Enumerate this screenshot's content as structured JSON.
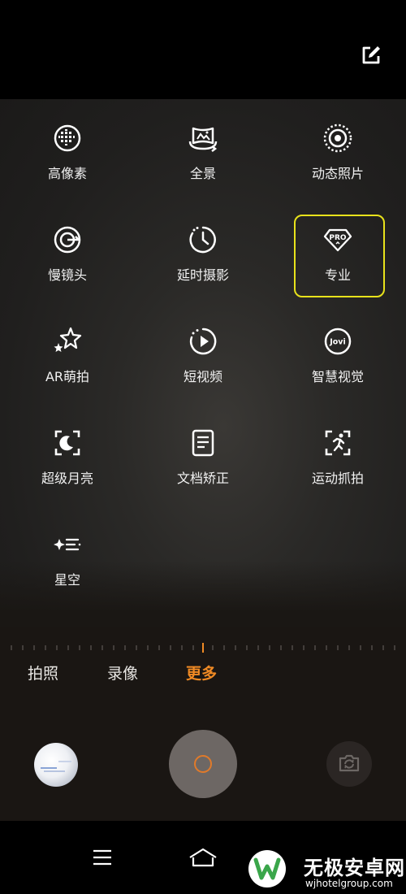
{
  "header": {
    "edit_icon": "edit-icon"
  },
  "modes": [
    {
      "label": "高像素",
      "icon": "hires-grid-icon"
    },
    {
      "label": "全景",
      "icon": "panorama-icon"
    },
    {
      "label": "动态照片",
      "icon": "live-photo-icon"
    },
    {
      "label": "慢镜头",
      "icon": "slow-motion-icon"
    },
    {
      "label": "延时摄影",
      "icon": "timelapse-clock-icon"
    },
    {
      "label": "专业",
      "icon": "pro-badge-icon",
      "badge_text": "PRO",
      "highlighted": true
    },
    {
      "label": "AR萌拍",
      "icon": "ar-stars-icon"
    },
    {
      "label": "短视频",
      "icon": "short-video-play-icon"
    },
    {
      "label": "智慧视觉",
      "icon": "jovi-icon",
      "badge_text": "Jovi"
    },
    {
      "label": "超级月亮",
      "icon": "moon-icon"
    },
    {
      "label": "文档矫正",
      "icon": "document-icon"
    },
    {
      "label": "运动抓拍",
      "icon": "sport-runner-icon"
    },
    {
      "label": "星空",
      "icon": "starry-sky-icon"
    }
  ],
  "tabs": [
    {
      "label": "拍照",
      "active": false
    },
    {
      "label": "录像",
      "active": false
    },
    {
      "label": "更多",
      "active": true
    }
  ],
  "controls": {
    "thumbnail": "gallery-thumbnail",
    "shutter": "shutter-button",
    "flip": "camera-flip-icon"
  },
  "nav": {
    "menu": "menu-icon",
    "home": "home-icon"
  },
  "colors": {
    "accent": "#f08a24",
    "highlight_box": "#e8e21b",
    "background": "#1b1a19"
  },
  "watermark": {
    "title": "无极安卓网",
    "url": "wjhotelgroup.com"
  }
}
